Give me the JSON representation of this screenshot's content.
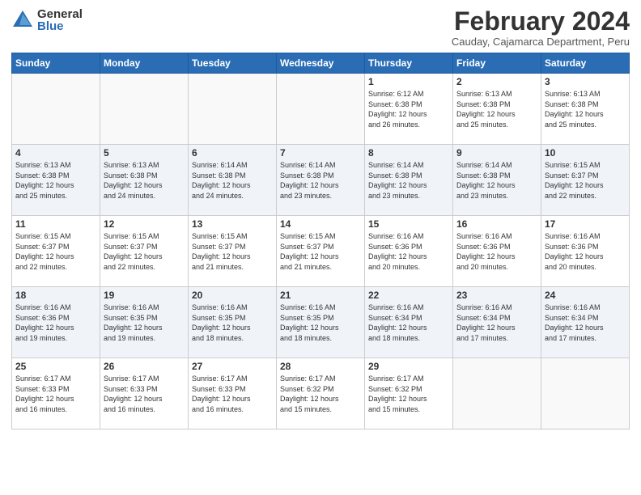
{
  "logo": {
    "general": "General",
    "blue": "Blue"
  },
  "title": "February 2024",
  "subtitle": "Cauday, Cajamarca Department, Peru",
  "weekdays": [
    "Sunday",
    "Monday",
    "Tuesday",
    "Wednesday",
    "Thursday",
    "Friday",
    "Saturday"
  ],
  "weeks": [
    [
      {
        "day": "",
        "empty": true
      },
      {
        "day": "",
        "empty": true
      },
      {
        "day": "",
        "empty": true
      },
      {
        "day": "",
        "empty": true
      },
      {
        "day": "1",
        "sunrise": "6:12 AM",
        "sunset": "6:38 PM",
        "daylight": "12 hours and 26 minutes."
      },
      {
        "day": "2",
        "sunrise": "6:13 AM",
        "sunset": "6:38 PM",
        "daylight": "12 hours and 25 minutes."
      },
      {
        "day": "3",
        "sunrise": "6:13 AM",
        "sunset": "6:38 PM",
        "daylight": "12 hours and 25 minutes."
      }
    ],
    [
      {
        "day": "4",
        "sunrise": "6:13 AM",
        "sunset": "6:38 PM",
        "daylight": "12 hours and 25 minutes."
      },
      {
        "day": "5",
        "sunrise": "6:13 AM",
        "sunset": "6:38 PM",
        "daylight": "12 hours and 24 minutes."
      },
      {
        "day": "6",
        "sunrise": "6:14 AM",
        "sunset": "6:38 PM",
        "daylight": "12 hours and 24 minutes."
      },
      {
        "day": "7",
        "sunrise": "6:14 AM",
        "sunset": "6:38 PM",
        "daylight": "12 hours and 23 minutes."
      },
      {
        "day": "8",
        "sunrise": "6:14 AM",
        "sunset": "6:38 PM",
        "daylight": "12 hours and 23 minutes."
      },
      {
        "day": "9",
        "sunrise": "6:14 AM",
        "sunset": "6:38 PM",
        "daylight": "12 hours and 23 minutes."
      },
      {
        "day": "10",
        "sunrise": "6:15 AM",
        "sunset": "6:37 PM",
        "daylight": "12 hours and 22 minutes."
      }
    ],
    [
      {
        "day": "11",
        "sunrise": "6:15 AM",
        "sunset": "6:37 PM",
        "daylight": "12 hours and 22 minutes."
      },
      {
        "day": "12",
        "sunrise": "6:15 AM",
        "sunset": "6:37 PM",
        "daylight": "12 hours and 22 minutes."
      },
      {
        "day": "13",
        "sunrise": "6:15 AM",
        "sunset": "6:37 PM",
        "daylight": "12 hours and 21 minutes."
      },
      {
        "day": "14",
        "sunrise": "6:15 AM",
        "sunset": "6:37 PM",
        "daylight": "12 hours and 21 minutes."
      },
      {
        "day": "15",
        "sunrise": "6:16 AM",
        "sunset": "6:36 PM",
        "daylight": "12 hours and 20 minutes."
      },
      {
        "day": "16",
        "sunrise": "6:16 AM",
        "sunset": "6:36 PM",
        "daylight": "12 hours and 20 minutes."
      },
      {
        "day": "17",
        "sunrise": "6:16 AM",
        "sunset": "6:36 PM",
        "daylight": "12 hours and 20 minutes."
      }
    ],
    [
      {
        "day": "18",
        "sunrise": "6:16 AM",
        "sunset": "6:36 PM",
        "daylight": "12 hours and 19 minutes."
      },
      {
        "day": "19",
        "sunrise": "6:16 AM",
        "sunset": "6:35 PM",
        "daylight": "12 hours and 19 minutes."
      },
      {
        "day": "20",
        "sunrise": "6:16 AM",
        "sunset": "6:35 PM",
        "daylight": "12 hours and 18 minutes."
      },
      {
        "day": "21",
        "sunrise": "6:16 AM",
        "sunset": "6:35 PM",
        "daylight": "12 hours and 18 minutes."
      },
      {
        "day": "22",
        "sunrise": "6:16 AM",
        "sunset": "6:34 PM",
        "daylight": "12 hours and 18 minutes."
      },
      {
        "day": "23",
        "sunrise": "6:16 AM",
        "sunset": "6:34 PM",
        "daylight": "12 hours and 17 minutes."
      },
      {
        "day": "24",
        "sunrise": "6:16 AM",
        "sunset": "6:34 PM",
        "daylight": "12 hours and 17 minutes."
      }
    ],
    [
      {
        "day": "25",
        "sunrise": "6:17 AM",
        "sunset": "6:33 PM",
        "daylight": "12 hours and 16 minutes."
      },
      {
        "day": "26",
        "sunrise": "6:17 AM",
        "sunset": "6:33 PM",
        "daylight": "12 hours and 16 minutes."
      },
      {
        "day": "27",
        "sunrise": "6:17 AM",
        "sunset": "6:33 PM",
        "daylight": "12 hours and 16 minutes."
      },
      {
        "day": "28",
        "sunrise": "6:17 AM",
        "sunset": "6:32 PM",
        "daylight": "12 hours and 15 minutes."
      },
      {
        "day": "29",
        "sunrise": "6:17 AM",
        "sunset": "6:32 PM",
        "daylight": "12 hours and 15 minutes."
      },
      {
        "day": "",
        "empty": true
      },
      {
        "day": "",
        "empty": true
      }
    ]
  ],
  "labels": {
    "sunrise": "Sunrise:",
    "sunset": "Sunset:",
    "daylight": "Daylight:"
  }
}
